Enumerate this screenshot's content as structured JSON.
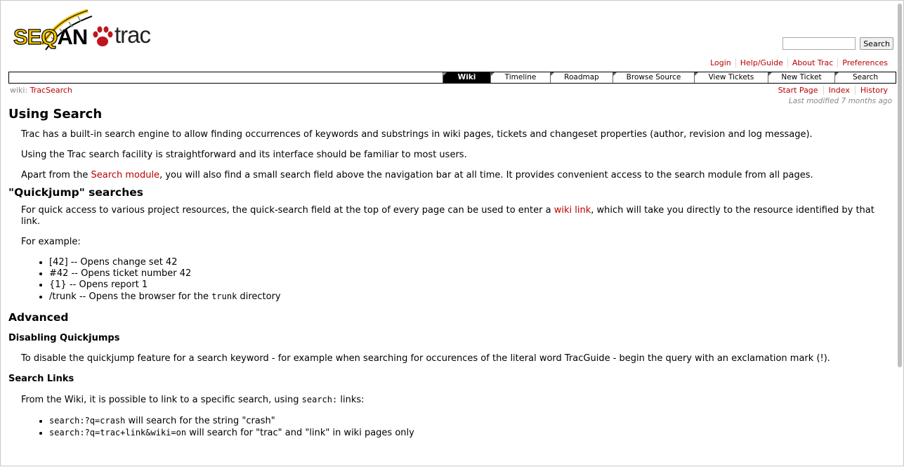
{
  "logo": {
    "seqan_a": "SEQ",
    "seqan_b": "AN",
    "trac": "trac"
  },
  "search": {
    "placeholder": "",
    "button": "Search"
  },
  "metanav": [
    "Login",
    "Help/Guide",
    "About Trac",
    "Preferences"
  ],
  "mainnav": [
    {
      "label": "Wiki",
      "active": true
    },
    {
      "label": "Timeline",
      "active": false
    },
    {
      "label": "Roadmap",
      "active": false
    },
    {
      "label": "Browse Source",
      "active": false
    },
    {
      "label": "View Tickets",
      "active": false
    },
    {
      "label": "New Ticket",
      "active": false
    },
    {
      "label": "Search",
      "active": false
    }
  ],
  "breadcrumb": {
    "prefix": "wiki:",
    "page": "TracSearch"
  },
  "ctxnav": [
    "Start Page",
    "Index",
    "History"
  ],
  "lastmod": {
    "prefix": "Last modified",
    "link": "7 months ago"
  },
  "content": {
    "h1": "Using Search",
    "p1": "Trac has a built-in search engine to allow finding occurrences of keywords and substrings in wiki pages, tickets and changeset properties (author, revision and log message).",
    "p2": "Using the Trac search facility is straightforward and its interface should be familiar to most users.",
    "p3": {
      "a": "Apart from the ",
      "link": "Search module",
      "b": ", you will also find a small search field above the navigation bar at all time. It provides convenient access to the search module from all pages."
    },
    "h2_quick": "\"Quickjump\" searches",
    "p4": {
      "a": "For quick access to various project resources, the quick-search field at the top of every page can be used to enter a ",
      "link": "wiki link",
      "b": ", which will take you directly to the resource identified by that link."
    },
    "p5": "For example:",
    "list1": [
      "[42] -- Opens change set 42",
      "#42 -- Opens ticket number 42",
      "{1} -- Opens report 1"
    ],
    "list1_last": {
      "a": "/trunk -- Opens the browser for the ",
      "code": "trunk",
      "b": " directory"
    },
    "h2_adv": "Advanced",
    "h3_dis": "Disabling Quickjumps",
    "p6": "To disable the quickjump feature for a search keyword - for example when searching for occurences of the literal word TracGuide - begin the query with an exclamation mark (!).",
    "h3_links": "Search Links",
    "p7": {
      "a": "From the Wiki, it is possible to link to a specific search, using ",
      "code": "search:",
      "b": " links:"
    },
    "list2": [
      {
        "code": "search:?q=crash",
        "text": " will search for the string \"crash\""
      },
      {
        "code": "search:?q=trac+link&wiki=on",
        "text": " will search for \"trac\" and \"link\" in wiki pages only"
      }
    ]
  }
}
